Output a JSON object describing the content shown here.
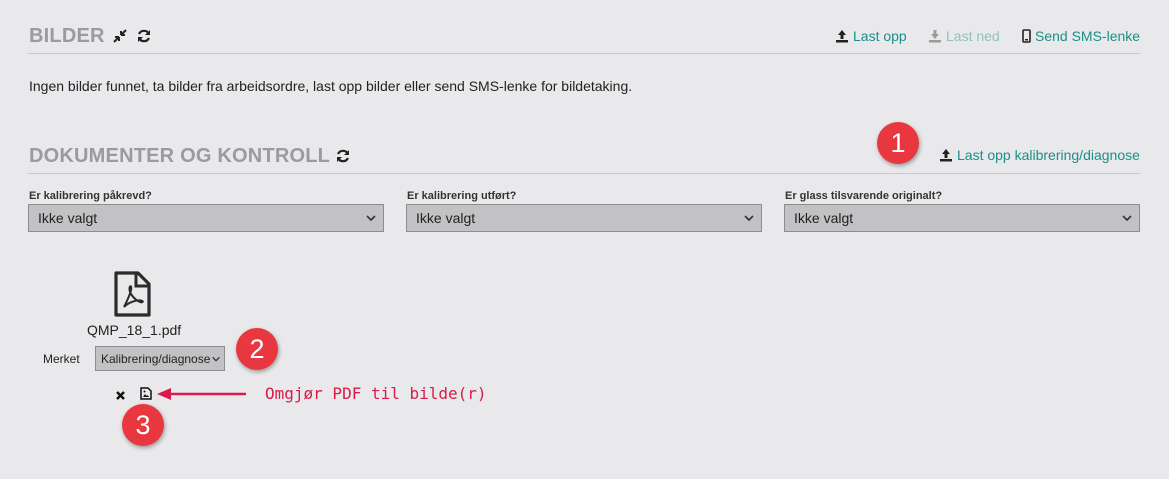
{
  "bilder": {
    "title": "BILDER",
    "icons": [
      "compress-icon",
      "refresh-icon"
    ],
    "actions": {
      "upload": "Last opp",
      "download": "Last ned",
      "sms": "Send SMS-lenke"
    },
    "empty_message": "Ingen bilder funnet, ta bilder fra arbeidsordre, last opp bilder eller send SMS-lenke for bildetaking."
  },
  "dokumenter": {
    "title": "DOKUMENTER OG KONTROLL",
    "upload_calibration": "Last opp kalibrering/diagnose",
    "fields": [
      {
        "label": "Er kalibrering påkrevd?",
        "value": "Ikke valgt"
      },
      {
        "label": "Er kalibrering utført?",
        "value": "Ikke valgt"
      },
      {
        "label": "Er glass tilsvarende originalt?",
        "value": "Ikke valgt"
      }
    ],
    "file": {
      "name": "QMP_18_1.pdf",
      "tag_label": "Merket",
      "tag_value": "Kalibrering/diagnose"
    }
  },
  "annotations": {
    "badge1": "1",
    "badge2": "2",
    "badge3": "3",
    "arrow_text": "Omgjør PDF til bilde(r)"
  },
  "colors": {
    "accent": "#1a8f8a",
    "badge": "#e8373f",
    "annotation": "#d81b4a",
    "title": "#9a9a9f"
  }
}
